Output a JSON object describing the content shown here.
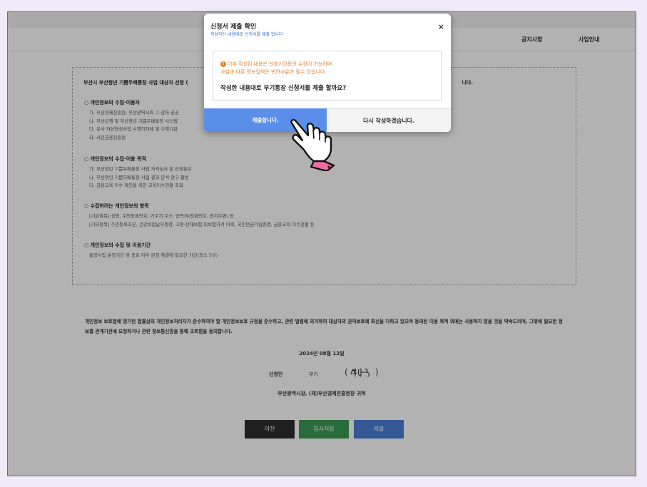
{
  "nav": {
    "items": [
      "공지사항",
      "사업안내"
    ]
  },
  "consent": {
    "intro": "부산시 부산청년 기쁨두배통장 사업 대상자 선정 (",
    "intro_tail": "니다.",
    "sections": [
      {
        "title": "○ 개인정보의 수집·이용자",
        "lines": [
          "가. 부산경제진흥원, 부산광역시와 그 산하 공공",
          "나. 부산은행 및 부산청년 기쁨두배통장 시스템",
          "다. 유사 자산형성사업 시행지자체 및 수행기관",
          "라. 서민금융진흥원"
        ]
      },
      {
        "title": "○ 개인정보의 수집·이용 목적",
        "lines": [
          "가. 부산청년 기쁨두배통장 사업 자격심사 및 선정통보",
          "나. 부산청년 기쁨두배통장 사업 결과 분석 연구 활용",
          "다. 금융교육 이수 확인을 위한 교육이수현황 조회"
        ]
      },
      {
        "title": "○ 수집하려는 개인정보의 항목",
        "lines": [
          "[기본항목] 성명, 주민등록번호, 거주지 주소, 연락처(전화번호, 전자우편) 등",
          "[기타항목] 주민등록초본, 건강보험납부증명, 고용·산재보험 피보험자격 이력, 국민연금가입증명, 금융교육 이수현황 등"
        ]
      },
      {
        "title": "○ 개인정보의 수집 및 이용기간",
        "lines": [
          "통장사업 운영기간 및 종료 이후 분쟁 해결에 필요한 기간(최소 5년)"
        ]
      }
    ]
  },
  "statement": "개인정보 보호법에 명기된 법률상의 개인정보처리자가 준수하여야 할 개인정보보호 규정을 준수하고, 관련 법령에 의거하여 대상자의 권익보호에 최선을 다하고 있으며 동의된 이용 목적 외에는 사용하지 않을 것을 약속드리며, 그밖에 필요한 정보를 관계기관에 요청하거나 관련 정보통신망을 통해 조회함을 동의합니다.",
  "signature": {
    "date": "2024년 08월 12일",
    "applicant_label": "신청인",
    "applicant_name": "부기",
    "paren_open": "(",
    "paren_close": ")",
    "recipient": "부산광역시장, (재)부산경제진흥원장 귀하"
  },
  "buttons": {
    "prev": "이전",
    "temp_save": "임시저장",
    "submit": "제출"
  },
  "modal": {
    "title": "신청서 제출 확인",
    "subtitle": "작성하신 내용대로 신청서를 제출 합니다",
    "close": "×",
    "warning_line1": "이후 작성된 내용은 신청기간동안 수정이 가능하며",
    "warning_line2": "사실과 다른 정보입력은 반려사유가 될수 있습니다.",
    "question": "작성한 내용대로 부기통장 신청서를 제출 할까요?",
    "confirm": "제출합니다.",
    "rewrite": "다시 작성하겠습니다."
  },
  "colors": {
    "confirm": "#5a8ee8",
    "warning": "#e9812b",
    "submit": "#4a7fd3",
    "temp_save": "#3d9a57",
    "prev": "#2e2e2e"
  },
  "icons": [
    "warning-icon",
    "close-icon",
    "pointing-hand-cursor-icon",
    "signature-image"
  ]
}
